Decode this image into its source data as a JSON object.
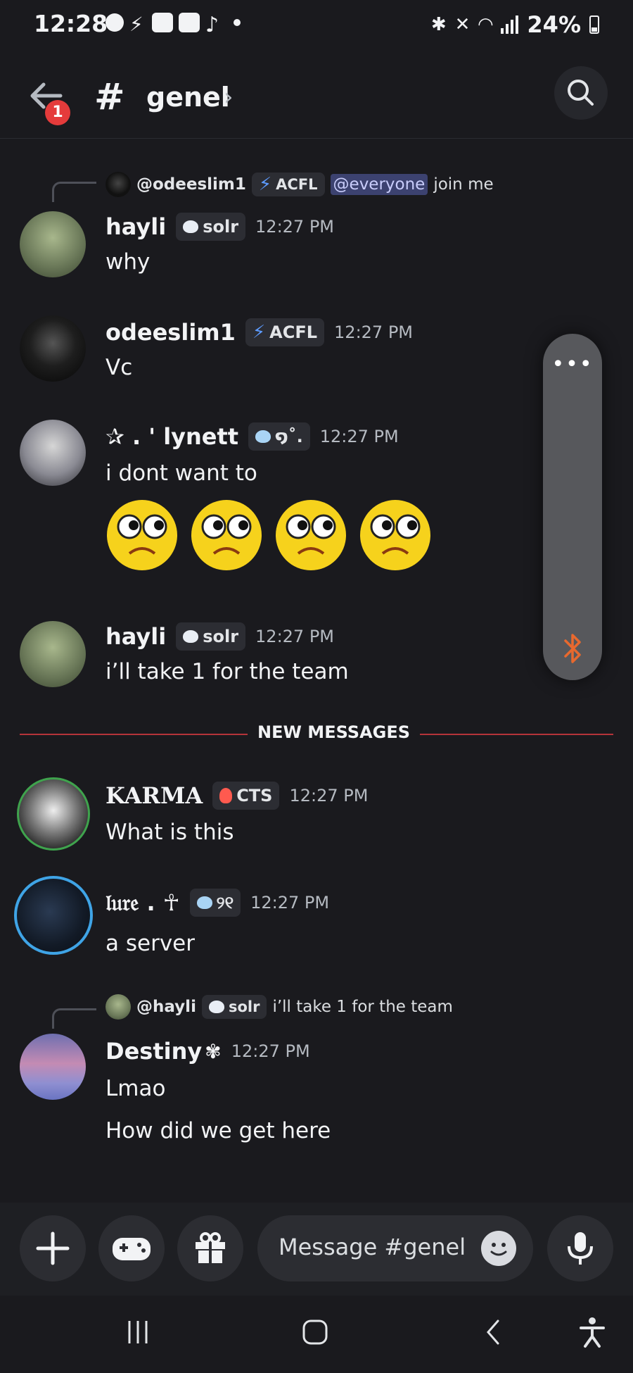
{
  "status_bar": {
    "time": "12:28",
    "battery": "24%"
  },
  "header": {
    "back_badge": "1",
    "hash": "#",
    "channel": "genel",
    "chevron": "›"
  },
  "reply1": {
    "user": "@odeeslim1",
    "tag": "ACFL",
    "mention": "@everyone",
    "text": "join me"
  },
  "messages": [
    {
      "user": "hayli",
      "tag": "solr",
      "time": "12:27 PM",
      "text": "why"
    },
    {
      "user": "odeeslim1",
      "tag": "ACFL",
      "time": "12:27 PM",
      "text": "Vc"
    },
    {
      "user": "✰ . ' lynett",
      "tag": "໑˚.",
      "time": "12:27 PM",
      "text": "i dont want to"
    },
    {
      "user": "hayli",
      "tag": "solr",
      "time": "12:27 PM",
      "text": "i’ll take 1 for the team"
    },
    {
      "user": "KARMA",
      "tag": "CTS",
      "time": "12:27 PM",
      "text": "What is this"
    },
    {
      "user": "𝔩𝔲𝔯𝔢 . ☥",
      "tag": "୨୧",
      "time": "12:27 PM",
      "text": "a server"
    },
    {
      "user": "Destiny",
      "time": "12:27 PM",
      "text": "Lmao",
      "text2": "How did we get here"
    }
  ],
  "reply2": {
    "user": "@hayli",
    "tag": "solr",
    "text": "i’ll take 1 for the team"
  },
  "divider": "NEW MESSAGES",
  "float_panel": {
    "dots": "•••"
  },
  "composer": {
    "placeholder": "Message #genel"
  },
  "colors": {
    "background": "#1a1a1e",
    "divider": "#b5343a",
    "badge": "#e53b3b",
    "bluetooth": "#e8692e"
  }
}
